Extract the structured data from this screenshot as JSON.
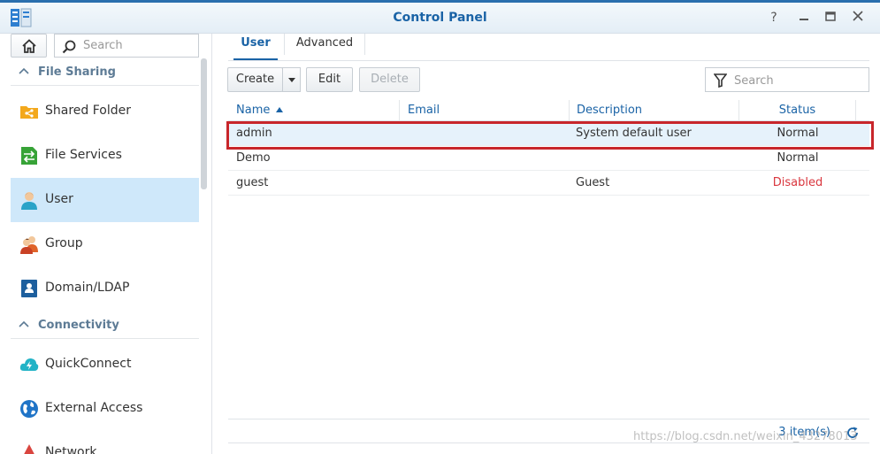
{
  "window": {
    "title": "Control Panel",
    "buttons": [
      "help-icon",
      "minimize-icon",
      "maximize-icon",
      "close-icon"
    ]
  },
  "sidebar": {
    "search_placeholder": "Search",
    "sections": [
      {
        "label": "File Sharing",
        "items": [
          {
            "label": "Shared Folder",
            "icon": "shared-folder-icon"
          },
          {
            "label": "File Services",
            "icon": "file-services-icon"
          },
          {
            "label": "User",
            "icon": "user-icon",
            "active": true
          },
          {
            "label": "Group",
            "icon": "group-icon"
          },
          {
            "label": "Domain/LDAP",
            "icon": "domain-ldap-icon"
          }
        ]
      },
      {
        "label": "Connectivity",
        "items": [
          {
            "label": "QuickConnect",
            "icon": "quickconnect-icon"
          },
          {
            "label": "External Access",
            "icon": "external-access-icon"
          },
          {
            "label": "Network",
            "icon": "network-icon"
          }
        ]
      }
    ]
  },
  "tabs": [
    {
      "label": "User",
      "active": true
    },
    {
      "label": "Advanced"
    }
  ],
  "toolbar": {
    "create": "Create",
    "edit": "Edit",
    "delete": "Delete",
    "search_placeholder": "Search"
  },
  "table": {
    "columns": [
      "Name",
      "Email",
      "Description",
      "Status"
    ],
    "rows": [
      {
        "name": "admin",
        "email": "",
        "description": "System default user",
        "status": "Normal",
        "selected": true
      },
      {
        "name": "Demo",
        "email": "",
        "description": "",
        "status": "Normal"
      },
      {
        "name": "guest",
        "email": "",
        "description": "Guest",
        "status": "Disabled"
      }
    ]
  },
  "footer": {
    "count": "3 item(s)"
  },
  "colors": {
    "accent": "#1a63a6",
    "disabled_status": "#d9363e",
    "selection_outline": "#c8262b",
    "active_nav": "#cfe8fa"
  },
  "watermark": "https://blog.csdn.net/weixin_43278013"
}
